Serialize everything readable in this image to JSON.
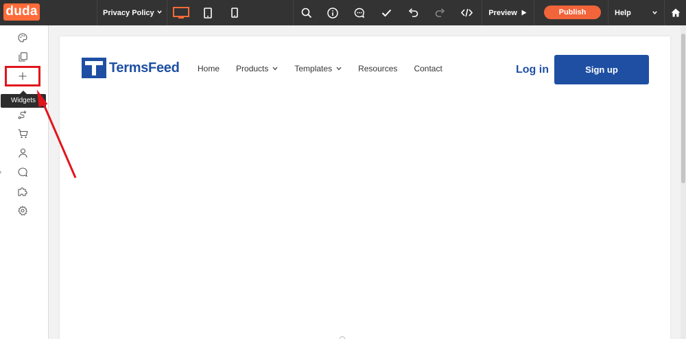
{
  "topbar": {
    "logo": "duda",
    "page_name": "Privacy Policy",
    "preview_label": "Preview",
    "publish_label": "Publish",
    "help_label": "Help"
  },
  "sidebar": {
    "tooltip": "Widgets"
  },
  "site": {
    "brand": "TermsFeed",
    "nav": [
      "Home",
      "Products",
      "Templates",
      "Resources",
      "Contact"
    ],
    "login": "Log in",
    "signup": "Sign up"
  },
  "colors": {
    "brand_orange": "#ff6b39",
    "topbar_bg": "#333333",
    "termsfeed_blue": "#1e4fa3",
    "annotation_red": "#e2141c"
  }
}
